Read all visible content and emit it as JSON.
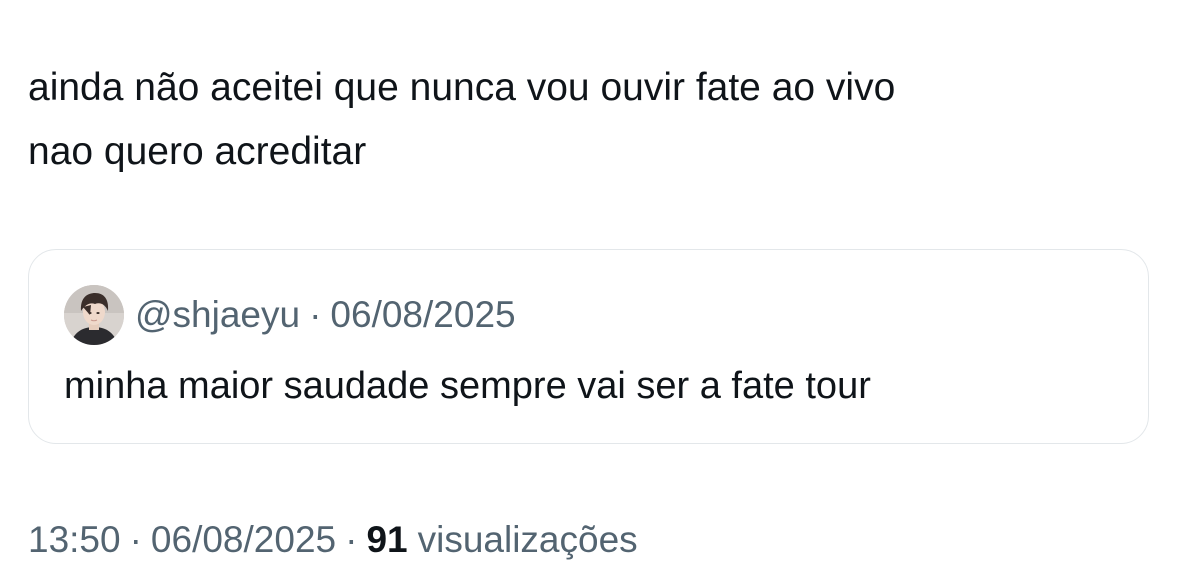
{
  "tweet": {
    "text_line_1": "ainda não aceitei que nunca vou ouvir fate ao vivo",
    "text_line_2": "nao quero acreditar"
  },
  "quoted_tweet": {
    "handle": "@shjaeyu",
    "separator": "·",
    "date": "06/08/2025",
    "text": "minha maior saudade sempre vai ser a fate tour"
  },
  "footer": {
    "time": "13:50",
    "separator_1": "·",
    "date": "06/08/2025",
    "separator_2": "·",
    "views_count": "91",
    "views_label": "visualizações"
  },
  "colors": {
    "text_primary": "#0f1419",
    "text_secondary": "#536471",
    "border": "#e3e7ea",
    "background": "#ffffff"
  }
}
